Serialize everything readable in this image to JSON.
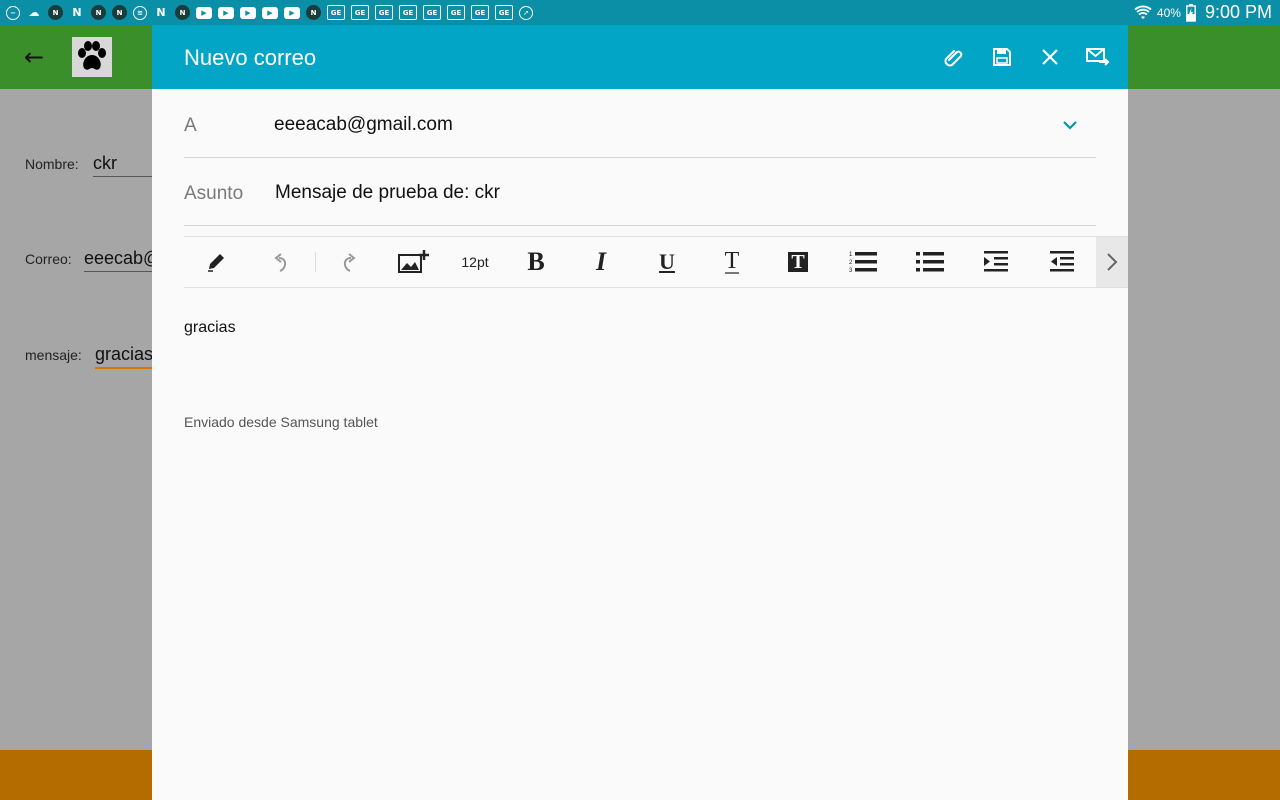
{
  "status_bar": {
    "battery": "40%",
    "time": "9:00 PM",
    "notification_icons": [
      "minus-circle",
      "cloud",
      "n-dark",
      "N",
      "n-dark",
      "n-dark",
      "spotify",
      "N",
      "n-dark",
      "youtube",
      "youtube",
      "youtube",
      "youtube",
      "youtube",
      "n-dark",
      "ge",
      "ge",
      "ge",
      "ge",
      "ge",
      "ge",
      "ge",
      "ge",
      "compass"
    ]
  },
  "background_app": {
    "form": {
      "nombre_label": "Nombre:",
      "nombre_value": "ckr",
      "correo_label": "Correo:",
      "correo_value": "eeecab@",
      "mensaje_label": "mensaje:",
      "mensaje_value": "gracias"
    }
  },
  "compose": {
    "title": "Nuevo correo",
    "to_label": "A",
    "to_value": "eeeacab@gmail.com",
    "subject_label": "Asunto",
    "subject_value": "Mensaje de prueba de: ckr",
    "font_size": "12pt",
    "body": "gracias",
    "signature": "Enviado desde Samsung tablet"
  },
  "colors": {
    "status_bar": "#0b8fa6",
    "header": "#03a5c6",
    "app_bar": "#3a8f2a",
    "bottom_bar": "#b46b00",
    "accent": "#0097a7"
  }
}
